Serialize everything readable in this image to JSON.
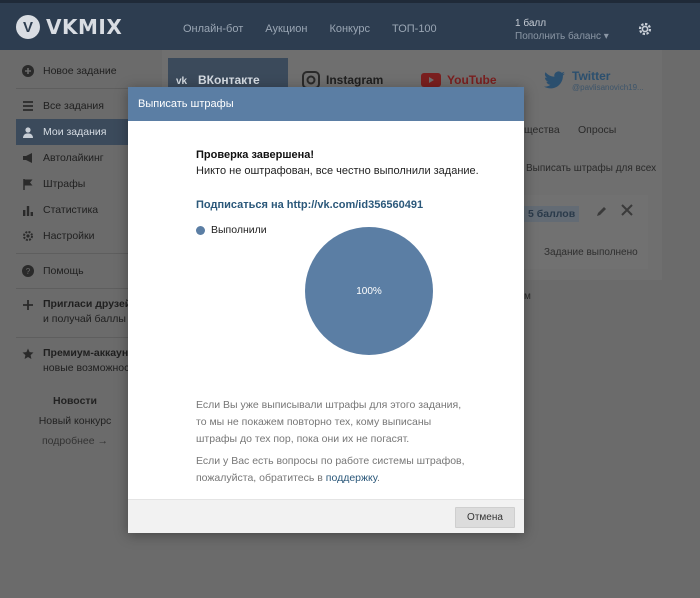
{
  "app": {
    "logo_text": "VKMIX"
  },
  "topbar": {
    "nav": [
      "Онлайн-бот",
      "Аукцион",
      "Конкурс",
      "ТОП-100"
    ],
    "balance": "1 балл",
    "balance_sub": "Пополнить баланс ▾"
  },
  "sidebar": {
    "items": [
      {
        "label": "Новое задание",
        "icon": "plus-circle-icon"
      },
      {
        "label": "Все задания",
        "icon": "list-icon"
      },
      {
        "label": "Мои задания",
        "icon": "user-icon"
      },
      {
        "label": "Автолайкинг",
        "icon": "megaphone-icon"
      },
      {
        "label": "Штрафы",
        "icon": "flag-icon"
      },
      {
        "label": "Статистика",
        "icon": "bar-chart-icon"
      },
      {
        "label": "Настройки",
        "icon": "gear-icon"
      },
      {
        "label": "Помощь",
        "icon": "question-circle-icon"
      }
    ],
    "invite_title": "Пригласи друзей",
    "invite_sub": "и получай баллы",
    "premium_title": "Премиум-аккаунт",
    "premium_sub": "новые возможности"
  },
  "news": {
    "title": "Новости",
    "item": "Новый конкурс",
    "more": "подробнее →"
  },
  "services": {
    "vk": "ВКонтакте",
    "instagram": "Instagram",
    "youtube": "YouTube",
    "twitter": "Twitter",
    "twitter_handle": "@pavlisanovich19..."
  },
  "background": {
    "tab_partial": "щества",
    "tab_polls": "Опросы",
    "penalties_all": "Выписать штрафы для всех",
    "points": "5 баллов",
    "task_done": "Задание выполнено",
    "partial_m": "м"
  },
  "modal": {
    "title": "Выписать штрафы",
    "check_title": "Проверка завершена!",
    "check_sub": "Никто не оштрафован, все честно выполнили задание.",
    "subscribe_link": "Подписаться на http://vk.com/id356560491",
    "legend_label": "Выполнили",
    "pie_label": "100%",
    "info1": "Если Вы уже выписывали штрафы для этого задания, то мы не покажем повторно тех, кому выписаны штрафы до тех пор, пока они их не погасят.",
    "info2_prefix": "Если у Вас есть вопросы по работе системы штрафов, пожалуйста, обратитесь в",
    "info2_link": "поддержку",
    "info2_suffix": ".",
    "cancel_label": "Отмена"
  },
  "colors": {
    "header": "#2d3d50",
    "accent": "#5b7ea4",
    "link": "#2b587a"
  },
  "chart_data": {
    "type": "pie",
    "slices": [
      {
        "label": "Выполнили",
        "value": 100
      }
    ],
    "labels": [
      "100%"
    ]
  }
}
